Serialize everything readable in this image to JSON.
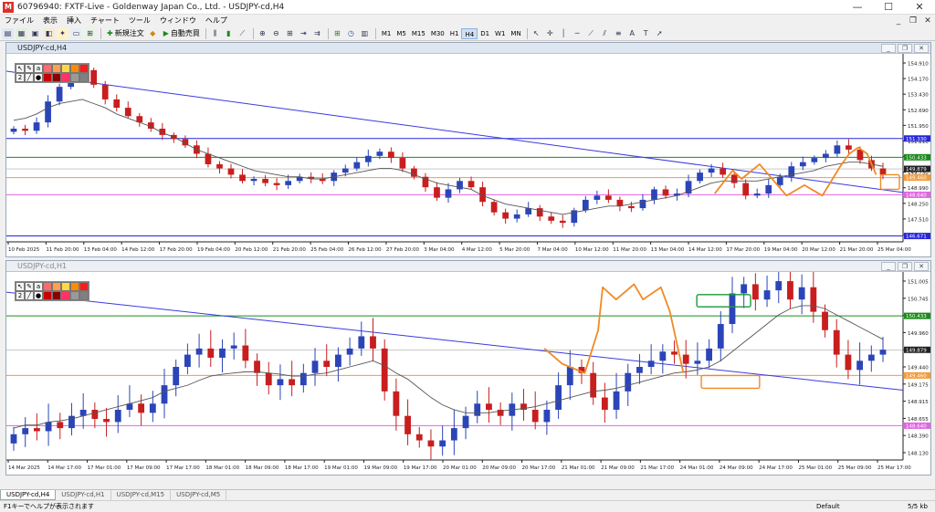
{
  "window": {
    "title": "60796940: FXTF-Live - Goldenway Japan Co., Ltd. - USDJPY-cd,H4",
    "icon": "mt4-icon",
    "controls": [
      "—",
      "☐",
      "✕"
    ]
  },
  "menu": {
    "items": [
      "ファイル",
      "表示",
      "挿入",
      "チャート",
      "ツール",
      "ウィンドウ",
      "ヘルプ"
    ],
    "mdi_controls": [
      "_",
      "❐",
      "✕"
    ]
  },
  "toolbar": {
    "new_order_label": "新規注文",
    "autotrade_label": "自動売買",
    "timeframes": [
      "M1",
      "M5",
      "M15",
      "M30",
      "H1",
      "H4",
      "D1",
      "W1",
      "MN"
    ],
    "active_timeframe": "H4"
  },
  "chart_data": [
    {
      "type": "candlestick",
      "title": "USDJPY-cd,H4",
      "x_ticks": [
        "10 Feb 2025",
        "11 Feb 20:00",
        "13 Feb 04:00",
        "14 Feb 12:00",
        "17 Feb 20:00",
        "19 Feb 04:00",
        "20 Feb 12:00",
        "21 Feb 20:00",
        "25 Feb 04:00",
        "26 Feb 12:00",
        "27 Feb 20:00",
        "3 Mar 04:00",
        "4 Mar 12:00",
        "5 Mar 20:00",
        "7 Mar 04:00",
        "10 Mar 12:00",
        "11 Mar 20:00",
        "13 Mar 04:00",
        "14 Mar 12:00",
        "17 Mar 20:00",
        "19 Mar 04:00",
        "20 Mar 12:00",
        "21 Mar 20:00",
        "25 Mar 04:00"
      ],
      "y_ticks": [
        "154.910",
        "154.170",
        "153.430",
        "152.690",
        "151.950",
        "151.210",
        "150.470",
        "149.730",
        "148.990",
        "148.250",
        "147.510",
        "146.770"
      ],
      "ylim": [
        146.39,
        155.29
      ],
      "price_labels": [
        {
          "value": 151.33,
          "text": "151.330",
          "color": "#2727d9"
        },
        {
          "value": 150.433,
          "text": "150.433",
          "color": "#1a8a1a"
        },
        {
          "value": 149.879,
          "text": "149.879",
          "color": "#222222"
        },
        {
          "value": 149.46,
          "text": "149.460",
          "color": "#f39c3a"
        },
        {
          "value": 148.64,
          "text": "148.640",
          "color": "#e066e0"
        },
        {
          "value": 146.671,
          "text": "146.671",
          "color": "#2727d9"
        }
      ],
      "close_series": [
        151.8,
        151.7,
        152.1,
        153.1,
        153.8,
        154.3,
        154.6,
        153.9,
        153.2,
        152.8,
        152.4,
        152.1,
        151.8,
        151.5,
        151.3,
        151.0,
        150.6,
        150.1,
        149.9,
        149.6,
        149.3,
        149.4,
        149.2,
        149.1,
        149.3,
        149.5,
        149.4,
        149.3,
        149.7,
        149.9,
        150.2,
        150.5,
        150.7,
        150.4,
        149.9,
        149.5,
        149.0,
        148.5,
        148.9,
        149.3,
        149.0,
        148.3,
        147.8,
        147.5,
        147.7,
        148.0,
        147.6,
        147.4,
        147.3,
        147.9,
        148.4,
        148.6,
        148.4,
        148.1,
        148.0,
        148.4,
        148.9,
        148.6,
        148.7,
        149.3,
        149.7,
        149.9,
        149.6,
        149.2,
        148.6,
        148.7,
        149.1,
        149.5,
        150.0,
        150.2,
        150.4,
        150.6,
        151.0,
        150.8,
        150.3,
        149.9,
        149.6
      ],
      "ma_series": [
        152.2,
        152.3,
        152.5,
        152.8,
        153.0,
        153.1,
        153.2,
        153.0,
        152.8,
        152.5,
        152.3,
        152.1,
        151.9,
        151.6,
        151.4,
        151.1,
        150.8,
        150.6,
        150.4,
        150.2,
        150.0,
        149.8,
        149.7,
        149.6,
        149.5,
        149.5,
        149.4,
        149.4,
        149.5,
        149.6,
        149.7,
        149.8,
        149.9,
        149.9,
        149.8,
        149.6,
        149.4,
        149.2,
        149.1,
        149.0,
        148.9,
        148.6,
        148.4,
        148.2,
        148.1,
        148.0,
        147.9,
        147.8,
        147.7,
        147.8,
        147.9,
        148.0,
        148.1,
        148.1,
        148.2,
        148.3,
        148.4,
        148.5,
        148.6,
        148.8,
        149.0,
        149.2,
        149.3,
        149.3,
        149.3,
        149.3,
        149.4,
        149.5,
        149.6,
        149.7,
        149.8,
        150.0,
        150.1,
        150.2,
        150.2,
        150.1,
        150.0
      ],
      "ma_color": "#555555",
      "bull_color": "#2b45b8",
      "bear_color": "#c81e1e",
      "trendline": {
        "from": [
          0,
          154.55
        ],
        "to": [
          1,
          148.75
        ],
        "color": "#3a3adf"
      },
      "annotations": [
        {
          "type": "zigzag",
          "color": "#f08a24",
          "points": [
            [
              0.79,
              148.7
            ],
            [
              0.81,
              149.8
            ],
            [
              0.82,
              149.4
            ],
            [
              0.84,
              150.1
            ],
            [
              0.87,
              148.6
            ],
            [
              0.89,
              149.1
            ],
            [
              0.91,
              148.6
            ],
            [
              0.93,
              150.0
            ],
            [
              0.94,
              150.6
            ],
            [
              0.95,
              150.9
            ],
            [
              0.96,
              150.6
            ],
            [
              0.97,
              149.6
            ]
          ]
        },
        {
          "type": "box",
          "color": "#f08a24",
          "from": [
            0.975,
            149.6
          ],
          "to": [
            1.05,
            148.9
          ]
        }
      ]
    },
    {
      "type": "candlestick",
      "title": "USDJPY-cd,H1",
      "x_ticks": [
        "14 Mar 2025",
        "14 Mar 17:00",
        "17 Mar 01:00",
        "17 Mar 09:00",
        "17 Mar 17:00",
        "18 Mar 01:00",
        "18 Mar 09:00",
        "18 Mar 17:00",
        "19 Mar 01:00",
        "19 Mar 09:00",
        "19 Mar 17:00",
        "20 Mar 01:00",
        "20 Mar 09:00",
        "20 Mar 17:00",
        "21 Mar 01:00",
        "21 Mar 09:00",
        "21 Mar 17:00",
        "24 Mar 01:00",
        "24 Mar 09:00",
        "24 Mar 17:00",
        "25 Mar 01:00",
        "25 Mar 09:00",
        "25 Mar 17:00"
      ],
      "y_ticks": [
        "151.005",
        "150.745",
        "150.220",
        "149.960",
        "149.700",
        "149.440",
        "149.175",
        "148.915",
        "148.655",
        "148.390",
        "148.130"
      ],
      "ylim": [
        148.08,
        151.12
      ],
      "price_labels": [
        {
          "value": 150.433,
          "text": "150.433",
          "color": "#1a8a1a"
        },
        {
          "value": 149.879,
          "text": "149.879",
          "color": "#222222"
        },
        {
          "value": 149.46,
          "text": "149.460",
          "color": "#f39c3a"
        },
        {
          "value": 148.64,
          "text": "148.640",
          "color": "#e066e0"
        }
      ],
      "close_series": [
        148.5,
        148.6,
        148.55,
        148.7,
        148.6,
        148.8,
        148.9,
        148.75,
        148.7,
        148.9,
        149.0,
        148.85,
        149.0,
        149.3,
        149.6,
        149.8,
        149.9,
        149.75,
        149.9,
        149.95,
        149.7,
        149.5,
        149.3,
        149.4,
        149.3,
        149.5,
        149.7,
        149.6,
        149.8,
        149.9,
        150.1,
        149.9,
        149.2,
        148.8,
        148.5,
        148.4,
        148.3,
        148.4,
        148.6,
        148.8,
        149.0,
        148.9,
        148.8,
        149.0,
        148.9,
        148.7,
        148.9,
        149.3,
        149.6,
        149.5,
        149.1,
        148.9,
        149.2,
        149.5,
        149.6,
        149.7,
        149.85,
        149.8,
        149.65,
        149.7,
        149.9,
        150.3,
        150.8,
        150.95,
        150.7,
        150.85,
        151.0,
        150.7,
        150.9,
        150.5,
        150.2,
        149.8,
        149.55,
        149.7,
        149.8,
        149.88
      ],
      "ma_series": [
        148.6,
        148.65,
        148.65,
        148.7,
        148.72,
        148.75,
        148.8,
        148.85,
        148.9,
        148.95,
        149.0,
        149.05,
        149.1,
        149.2,
        149.25,
        149.3,
        149.38,
        149.45,
        149.48,
        149.5,
        149.52,
        149.52,
        149.5,
        149.48,
        149.45,
        149.45,
        149.48,
        149.5,
        149.55,
        149.6,
        149.65,
        149.7,
        149.62,
        149.5,
        149.4,
        149.25,
        149.1,
        148.98,
        148.9,
        148.85,
        148.85,
        148.85,
        148.88,
        148.9,
        148.92,
        148.95,
        149.0,
        149.05,
        149.1,
        149.15,
        149.2,
        149.22,
        149.25,
        149.3,
        149.35,
        149.4,
        149.45,
        149.5,
        149.52,
        149.55,
        149.6,
        149.7,
        149.85,
        150.0,
        150.15,
        150.3,
        150.45,
        150.55,
        150.6,
        150.6,
        150.55,
        150.45,
        150.35,
        150.25,
        150.15,
        150.05
      ],
      "ma_color": "#555555",
      "bull_color": "#2b45b8",
      "bear_color": "#c81e1e",
      "trendline": {
        "from": [
          0,
          150.82
        ],
        "to": [
          1,
          149.22
        ],
        "color": "#3a3adf"
      },
      "annotations": [
        {
          "type": "zigzag",
          "color": "#f08a24",
          "points": [
            [
              0.6,
              149.9
            ],
            [
              0.62,
              149.65
            ],
            [
              0.645,
              149.5
            ],
            [
              0.66,
              150.2
            ],
            [
              0.665,
              150.9
            ],
            [
              0.68,
              150.7
            ],
            [
              0.7,
              150.95
            ],
            [
              0.71,
              150.7
            ],
            [
              0.73,
              150.9
            ],
            [
              0.74,
              150.5
            ],
            [
              0.755,
              149.5
            ]
          ]
        },
        {
          "type": "box",
          "color": "#1a9a3a",
          "from": [
            0.77,
            150.78
          ],
          "to": [
            0.83,
            150.58
          ]
        },
        {
          "type": "box",
          "color": "#f08a24",
          "from": [
            0.775,
            149.46
          ],
          "to": [
            0.84,
            149.25
          ]
        }
      ]
    }
  ],
  "palette": {
    "symbols": [
      "↖",
      "✎",
      "a"
    ],
    "colors": [
      "#ff6a6a",
      "#ffa04a",
      "#ffd84a",
      "#ff8c00",
      "#ff1a1a",
      "#c80000",
      "#8b0000",
      "#ff3366",
      "#9a9a9a",
      "#808080",
      "#00a000",
      "#00d0d0",
      "#0080ff",
      "#ff00ff",
      "#ff66cc",
      "#f0f0f0"
    ]
  },
  "tabs": [
    "USDJPY-cd,H4",
    "USDJPY-cd,H1",
    "USDJPY-cd,M15",
    "USDJPY-cd,M5"
  ],
  "active_tab": "USDJPY-cd,H4",
  "status": {
    "help_text": "F1キーでヘルプが表示されます",
    "profile": "Default",
    "traffic": "5/5 kb"
  }
}
